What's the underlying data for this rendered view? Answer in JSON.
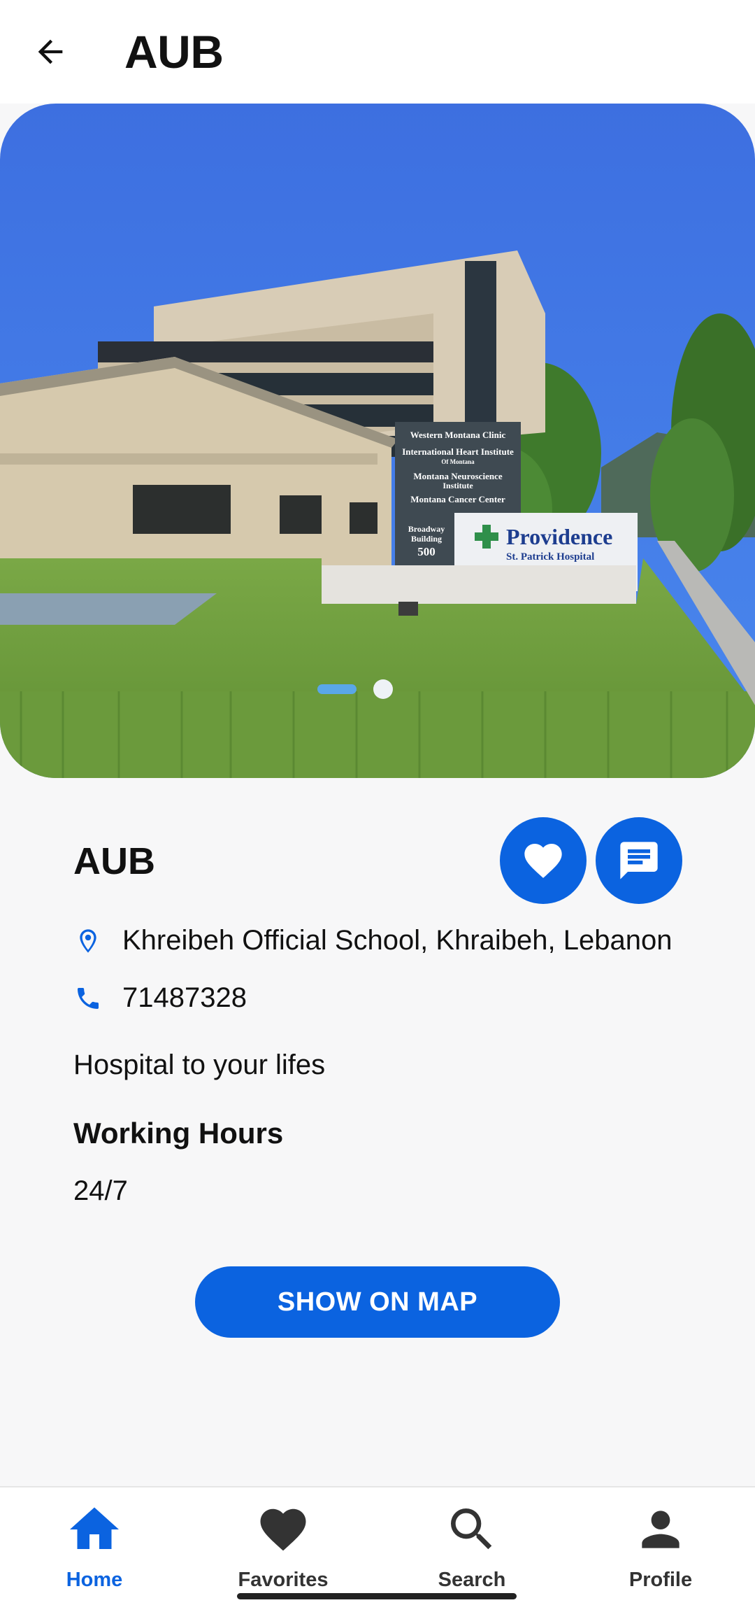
{
  "appbar": {
    "title": "AUB",
    "back_icon": "arrow-back-icon"
  },
  "hero": {
    "image_description_icon": "hospital-photo",
    "sign_lines": [
      "Western Montana Clinic",
      "International Heart Institute",
      "Of Montana",
      "Montana Neuroscience",
      "Institute",
      "Montana Cancer Center"
    ],
    "sign_address": [
      "Broadway",
      "Building",
      "500"
    ],
    "sign_brand": "Providence",
    "sign_brand_sub": "St. Patrick Hospital",
    "carousel": {
      "active_index": 0,
      "count": 2
    }
  },
  "details": {
    "name": "AUB",
    "address": "Khreibeh Official School, Khraibeh, Lebanon",
    "phone": "71487328",
    "description": "Hospital to your lifes",
    "hours_title": "Working Hours",
    "hours_value": "24/7",
    "map_button": "SHOW ON MAP"
  },
  "colors": {
    "primary": "#0b63e0",
    "background": "#f7f7f8",
    "nav_inactive": "#333333"
  },
  "nav": {
    "items": [
      {
        "label": "Home",
        "icon": "home-icon",
        "active": true
      },
      {
        "label": "Favorites",
        "icon": "heart-icon",
        "active": false
      },
      {
        "label": "Search",
        "icon": "search-icon",
        "active": false
      },
      {
        "label": "Profile",
        "icon": "person-icon",
        "active": false
      }
    ]
  }
}
